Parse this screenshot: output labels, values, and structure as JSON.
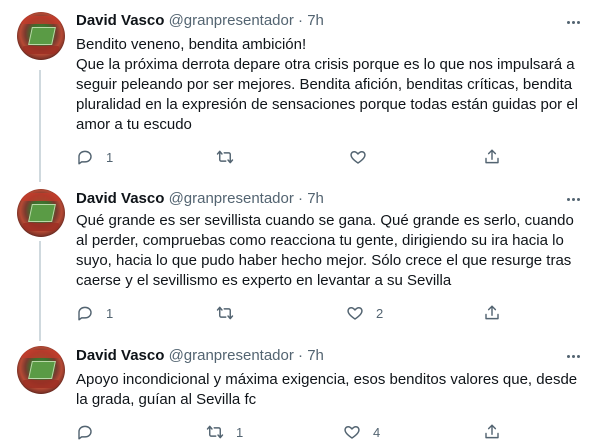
{
  "tweets": [
    {
      "author_name": "David Vasco",
      "author_handle": "@granpresentador",
      "separator": "·",
      "time": "7h",
      "lines": [
        "Bendito veneno, bendita ambición!",
        "Que la próxima derrota depare otra crisis porque es lo que nos impulsará a seguir peleando por ser mejores. Bendita afición, benditas críticas, bendita pluralidad en la expresión de sensaciones porque todas están guidas por el amor a tu escudo"
      ],
      "reply_count": "1",
      "retweet_count": "",
      "like_count": ""
    },
    {
      "author_name": "David Vasco",
      "author_handle": "@granpresentador",
      "separator": "·",
      "time": "7h",
      "lines": [
        "Qué grande es ser sevillista cuando se gana. Qué grande es serlo, cuando al perder, compruebas como reacciona tu gente, dirigiendo su ira hacia lo suyo, hacia lo que pudo haber hecho mejor. Sólo crece el que resurge tras caerse y el sevillismo es experto en levantar a su Sevilla"
      ],
      "reply_count": "1",
      "retweet_count": "",
      "like_count": "2"
    },
    {
      "author_name": "David Vasco",
      "author_handle": "@granpresentador",
      "separator": "·",
      "time": "7h",
      "lines": [
        "Apoyo incondicional y máxima exigencia, esos benditos valores que, desde la grada, guían al Sevilla fc"
      ],
      "reply_count": "",
      "retweet_count": "1",
      "like_count": "4"
    }
  ],
  "icons": {
    "more": "more-horizontal-icon",
    "reply": "reply-icon",
    "retweet": "retweet-icon",
    "like": "heart-icon",
    "share": "share-icon"
  },
  "colors": {
    "text": "#0f1419",
    "secondary": "#536471",
    "thread_line": "#cfd9de",
    "background": "#ffffff"
  }
}
